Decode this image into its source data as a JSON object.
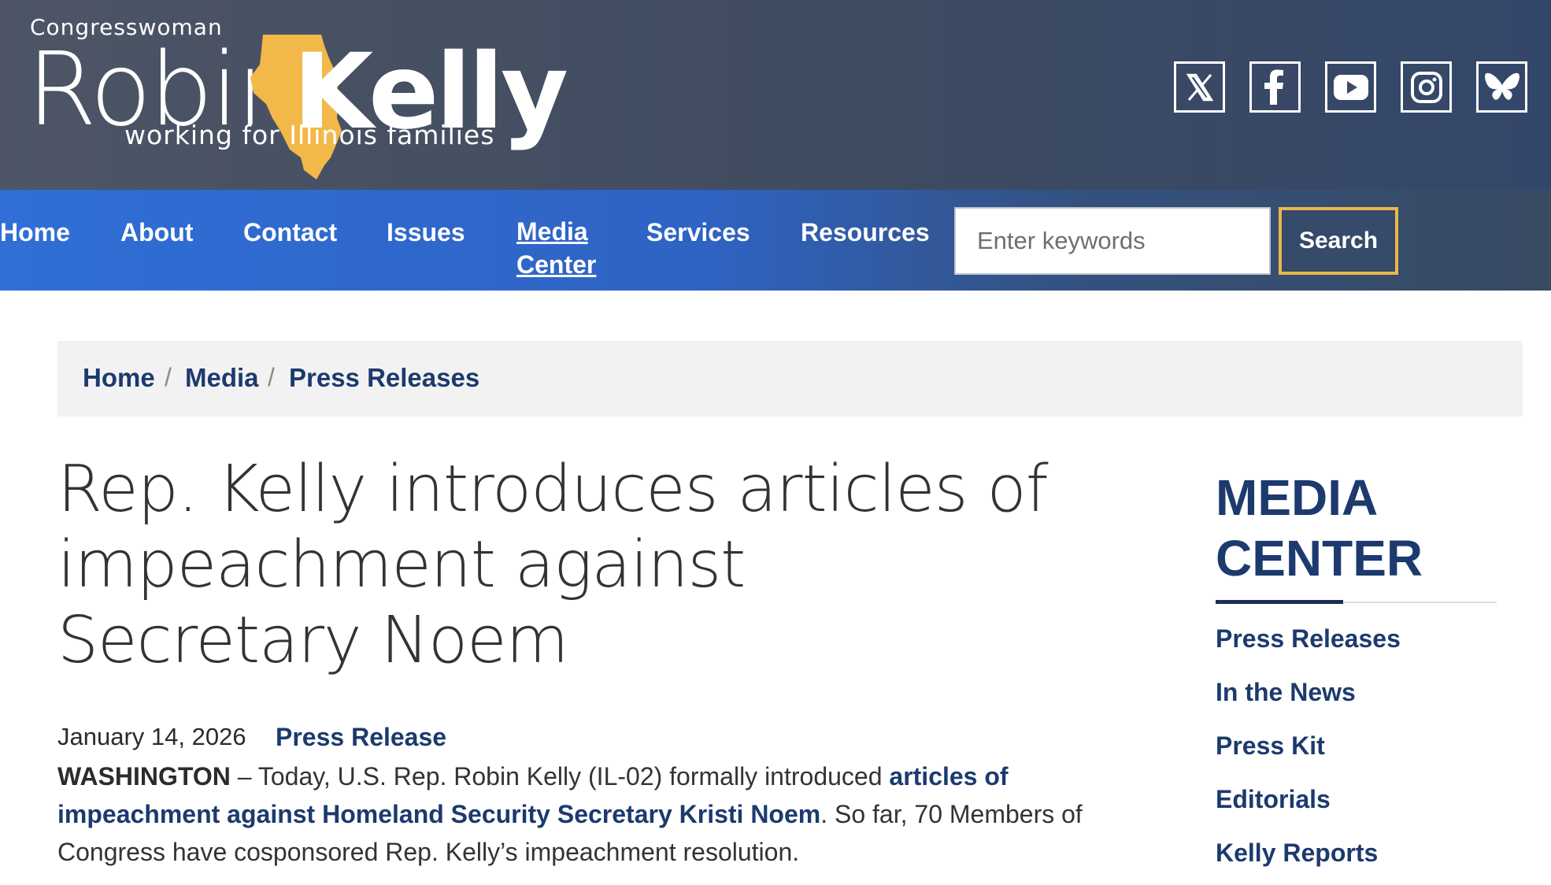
{
  "logo": {
    "top": "Congresswoman",
    "first": "Robin",
    "last": "Kelly",
    "tagline": "working for Illinois families"
  },
  "social": [
    "x-icon",
    "facebook-icon",
    "youtube-icon",
    "instagram-icon",
    "bluesky-icon"
  ],
  "nav": {
    "items": [
      "Home",
      "About",
      "Contact",
      "Issues",
      "Media Center",
      "Services",
      "Resources"
    ],
    "media_line1": "Media",
    "media_line2": "Center",
    "search_placeholder": "Enter keywords",
    "search_button": "Search"
  },
  "breadcrumb": [
    "Home",
    "Media",
    "Press Releases"
  ],
  "breadcrumb_sep": "/",
  "article": {
    "title": "Rep. Kelly introduces articles of impeachment against Secretary Noem",
    "date": "January 14, 2026",
    "type": "Press Release",
    "dateline": "WASHINGTON",
    "text1": " – Today, U.S. Rep. Robin Kelly (IL-02) formally introduced ",
    "link": "articles of impeachment against Homeland Security Secretary Kristi Noem",
    "text2": ". So far, 70 Members of Congress have cosponsored Rep. Kelly’s impeachment resolution."
  },
  "sidebar": {
    "title": "MEDIA CENTER",
    "links": [
      "Press Releases",
      "In the News",
      "Press Kit",
      "Editorials",
      "Kelly Reports"
    ]
  },
  "colors": {
    "header_bg": "#3f4b60",
    "nav_blue": "#2f6fd6",
    "accent_gold": "#e8b84a",
    "link_navy": "#1c3a6e",
    "illinois_gold": "#f2b94a"
  }
}
